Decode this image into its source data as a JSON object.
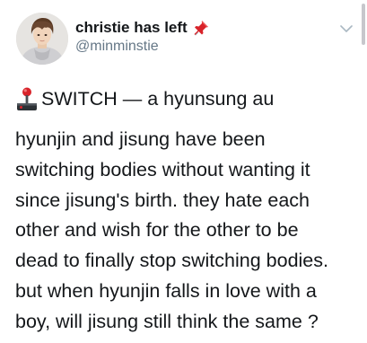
{
  "tweet": {
    "display_name": "christie has left",
    "handle": "@minminstie",
    "title": "SWITCH — a hyunsung au",
    "lines": [
      "hyunjin and jisung have been",
      "switching bodies without wanting it",
      "since jisung's birth. they hate each",
      "other and wish for the other to be",
      "dead to finally stop switching bodies.",
      "but when hyunjin falls in love with a",
      "boy, will jisung still think the same ?"
    ]
  },
  "icons": {
    "name_emoji": "pushpin-icon",
    "title_emoji": "joystick-icon",
    "menu": "chevron-down-icon"
  },
  "colors": {
    "text": "#14171a",
    "secondary": "#657786",
    "pin_red": "#d8232a",
    "chevron": "#aab8c2"
  }
}
